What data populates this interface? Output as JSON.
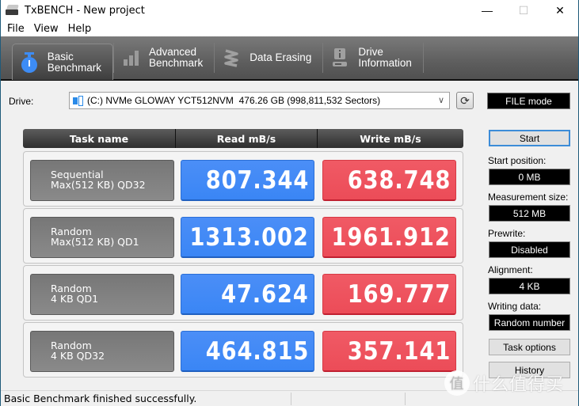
{
  "window": {
    "title": "TxBENCH - New project",
    "controls": {
      "minimize": "—",
      "maximize": "☐",
      "close": "✕"
    }
  },
  "menu": [
    "File",
    "View",
    "Help"
  ],
  "tabs": [
    {
      "label": "Basic\nBenchmark",
      "icon": "stopwatch-icon",
      "active": true
    },
    {
      "label": "Advanced\nBenchmark",
      "icon": "bar-chart-icon",
      "active": false
    },
    {
      "label": "Data Erasing",
      "icon": "eraser-spring-icon",
      "active": false
    },
    {
      "label": "Drive\nInformation",
      "icon": "drive-info-icon",
      "active": false
    }
  ],
  "drive": {
    "label": "Drive:",
    "selected": "(C:) NVMe GLOWAY YCT512NVM  476.26 GB (998,811,532 Sectors)",
    "refresh_icon": "refresh-icon",
    "mode": "FILE mode"
  },
  "table": {
    "headers": [
      "Task name",
      "Read mB/s",
      "Write mB/s"
    ],
    "rows": [
      {
        "task": "Sequential\nMax(512 KB) QD32",
        "read": "807.344",
        "write": "638.748"
      },
      {
        "task": "Random\nMax(512 KB) QD1",
        "read": "1313.002",
        "write": "1961.912"
      },
      {
        "task": "Random\n4 KB QD1",
        "read": "47.624",
        "write": "169.777"
      },
      {
        "task": "Random\n4 KB QD32",
        "read": "464.815",
        "write": "357.141"
      }
    ]
  },
  "side": {
    "start_label": "Start",
    "start_position_label": "Start position:",
    "start_position_value": "0 MB",
    "measurement_size_label": "Measurement size:",
    "measurement_size_value": "512 MB",
    "prewrite_label": "Prewrite:",
    "prewrite_value": "Disabled",
    "alignment_label": "Alignment:",
    "alignment_value": "4 KB",
    "writing_data_label": "Writing data:",
    "writing_data_value": "Random number",
    "task_options_label": "Task options",
    "history_label": "History"
  },
  "status": {
    "text": "Basic Benchmark finished successfully."
  },
  "watermark": {
    "circle": "值",
    "text": "什么值得买"
  },
  "colors": {
    "read": "#3a86f5",
    "write": "#ec4c58",
    "accent": "#3d8cf5"
  }
}
